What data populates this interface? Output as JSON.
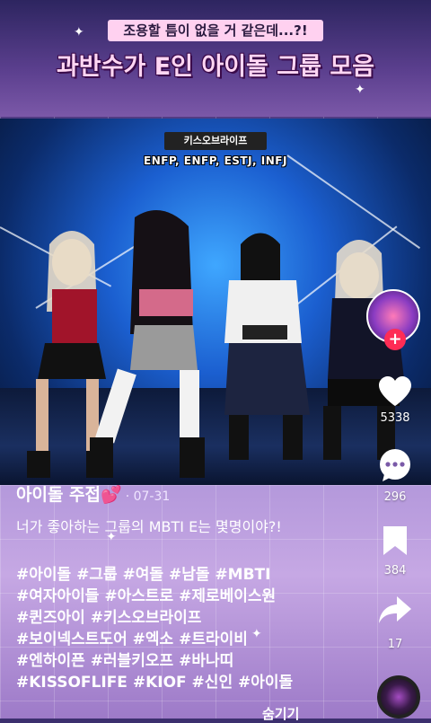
{
  "header": {
    "subtitle": "조용할 틈이 없을 거 같은데...?!",
    "headline": "과반수가 E인 아이돌 그룹 모음"
  },
  "video": {
    "group_chip": "키스오브라이프",
    "mbti_list": "ENFP, ENFP, ESTJ, INFJ"
  },
  "rail": {
    "like_count": "5338",
    "comment_count": "296",
    "save_count": "384",
    "share_count": "17"
  },
  "post": {
    "author": "아이돌 주접💕",
    "date": "· 07-31",
    "caption": "너가 좋아하는 그룹의 MBTI E는 몇명이야?!",
    "hashtag_lines": [
      "#아이돌 #그룹 #여돌 #남돌 #MBTI",
      "#여자아이들 #아스트로 #제로베이스원",
      "#퀸즈아이 #키스오브라이프",
      "#보이넥스트도어 #엑소 #트라이비",
      "#엔하이픈 #러블키오프 #바나띠",
      "#KISSOFLIFE #KIOF #신인 #아이돌"
    ],
    "more_label": "숨기기"
  },
  "colors": {
    "accent": "#fe2c55",
    "subtitle_bg": "#ffd1f0",
    "headline": "#ffd6f3"
  }
}
